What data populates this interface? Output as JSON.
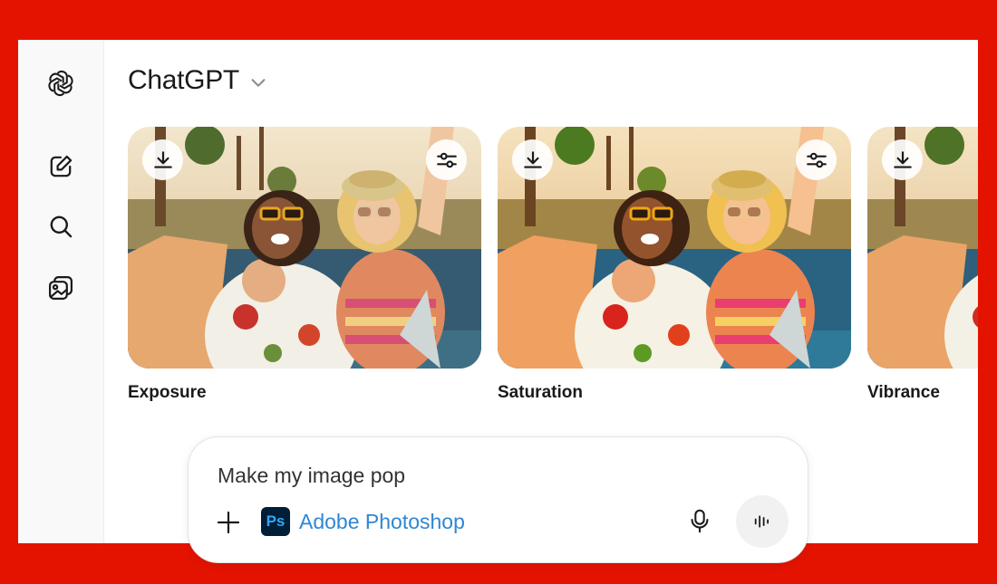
{
  "app": {
    "model_name": "ChatGPT",
    "model_picker_icon": "chevron-down-icon"
  },
  "sidebar": {
    "items": [
      {
        "name": "openai-logo-icon"
      },
      {
        "name": "new-chat-icon"
      },
      {
        "name": "search-icon"
      },
      {
        "name": "library-icon"
      }
    ]
  },
  "results": [
    {
      "label": "Exposure",
      "download_icon": "download-icon",
      "adjust_icon": "sliders-icon"
    },
    {
      "label": "Saturation",
      "download_icon": "download-icon",
      "adjust_icon": "sliders-icon"
    },
    {
      "label": "Vibrance",
      "download_icon": "download-icon",
      "adjust_icon": "sliders-icon"
    }
  ],
  "composer": {
    "value": "Make my image pop",
    "tool_label": "Adobe Photoshop",
    "tool_logo_text": "Ps"
  },
  "colors": {
    "background": "#e41300",
    "link": "#2f86d3",
    "ps_logo_bg": "#001e36",
    "ps_logo_fg": "#31a8ff"
  }
}
